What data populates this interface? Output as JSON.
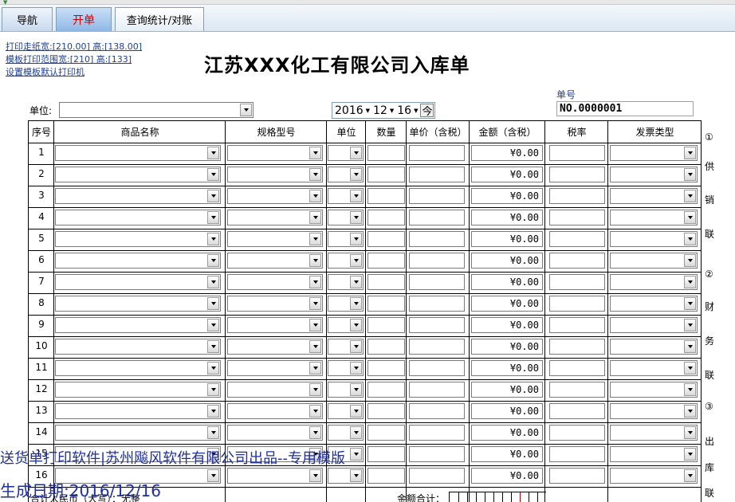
{
  "tabs": [
    {
      "label": "导航"
    },
    {
      "label": "开单"
    },
    {
      "label": "查询统计/对账"
    }
  ],
  "left_links": [
    "打印走纸宽:[210.00] 高:[138.00]",
    "模板打印范围宽:[210] 高:[133]",
    "设置模板默认打印机"
  ],
  "title": "江苏XXX化工有限公司入库单",
  "order_no": {
    "label": "单号",
    "value": "NO.0000001"
  },
  "unit": {
    "label": "单位:",
    "value": ""
  },
  "date": {
    "year": "2016",
    "month": "12",
    "day": "16",
    "today_button": "今"
  },
  "columns": [
    "序号",
    "商品名称",
    "规格型号",
    "单位",
    "数量",
    "单价（含税）",
    "金额（含税）",
    "税率",
    "发票类型"
  ],
  "rows": [
    {
      "no": "1",
      "amount": "¥0.00"
    },
    {
      "no": "2",
      "amount": "¥0.00"
    },
    {
      "no": "3",
      "amount": "¥0.00"
    },
    {
      "no": "4",
      "amount": "¥0.00"
    },
    {
      "no": "5",
      "amount": "¥0.00"
    },
    {
      "no": "6",
      "amount": "¥0.00"
    },
    {
      "no": "7",
      "amount": "¥0.00"
    },
    {
      "no": "8",
      "amount": "¥0.00"
    },
    {
      "no": "9",
      "amount": "¥0.00"
    },
    {
      "no": "10",
      "amount": "¥0.00"
    },
    {
      "no": "11",
      "amount": "¥0.00"
    },
    {
      "no": "12",
      "amount": "¥0.00"
    },
    {
      "no": "13",
      "amount": "¥0.00"
    },
    {
      "no": "14",
      "amount": "¥0.00"
    },
    {
      "no": "15",
      "amount": "¥0.00"
    },
    {
      "no": "16",
      "amount": "¥0.00"
    }
  ],
  "side_labels": [
    "①",
    "供",
    "销",
    "联",
    "②",
    "财",
    "务",
    "联",
    "③",
    "出",
    "库",
    "联"
  ],
  "totals": {
    "rmb_label": "合计人民币（大写）：无整",
    "amount_label": "金额合计："
  },
  "overlay": {
    "line1": "送货单打印软件|苏州飚风软件有限公司出品--专用模版",
    "line2": "生成日期:2016/12/16"
  }
}
